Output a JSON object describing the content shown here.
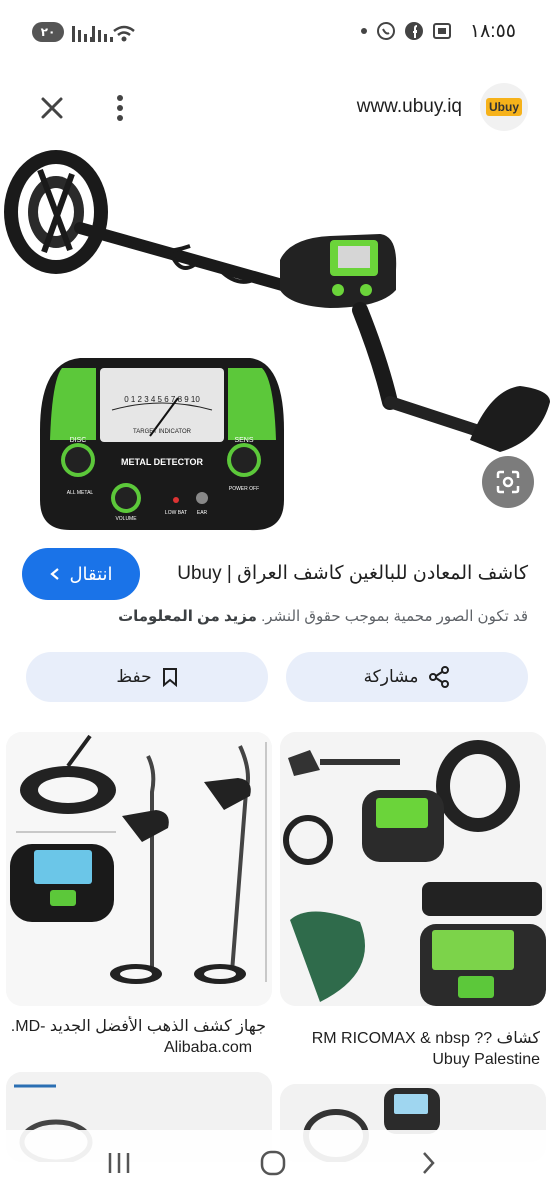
{
  "status_bar": {
    "time": "١٨:٥٥",
    "battery_badge": "٢٠"
  },
  "url_bar": {
    "url": "www.ubuy.iq",
    "logo_text": "Ubuy"
  },
  "hero": {
    "dial_numbers": "0 1 2 3 4 5 6 7 8 9 10",
    "panel_label": "METAL DETECTOR",
    "target_indicator": "TARGET INDICATOR",
    "disc": "DISC",
    "sens": "SENS",
    "all_metal": "ALL METAL",
    "power_off": "POWER OFF",
    "volume": "VOLUME",
    "low_bat": "LOW BAT",
    "ear": "EAR"
  },
  "result": {
    "goto_label": "انتقال",
    "title": "كاشف المعادن للبالغين كاشف العراق | Ubuy",
    "copyright_note": "قد تكون الصور محمية بموجب حقوق النشر.",
    "more_info": "مزيد من المعلومات"
  },
  "actions": {
    "save": "حفظ",
    "share": "مشاركة"
  },
  "related": [
    {
      "title": "جهاز كشف الذهب الأفضل الجديد -MD...",
      "source": "Alibaba.com"
    },
    {
      "title": "كشاف ?? RM RICOMAX & nbsp",
      "source": "Ubuy Palestine"
    }
  ],
  "colors": {
    "accent": "#1a73e8",
    "button_bg": "#e8eefa",
    "detector_green": "#6bd43a"
  }
}
